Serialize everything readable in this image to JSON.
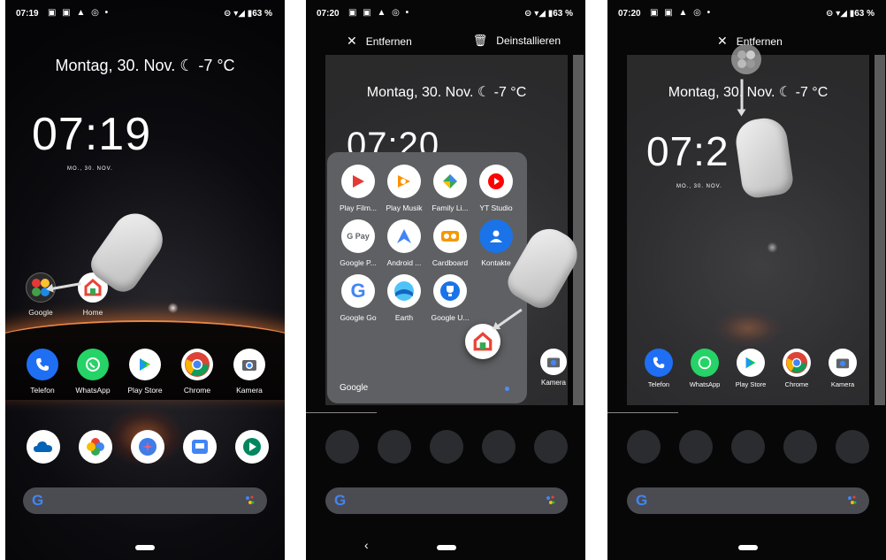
{
  "panels": [
    {
      "status": {
        "time": "07:19",
        "icons": "▣ ▣ ▲ ◎ •",
        "right": "⊝ ▾◢ ▮63 %"
      },
      "date_line": "Montag, 30. Nov. ☾ -7 °C",
      "clock": "07:19",
      "clock_sub": "MO., 30. NOV.",
      "folder_label": "Google",
      "home_label": "Home",
      "dock": [
        {
          "label": "Telefon",
          "icon": "phone-icon",
          "color": "#1e6ff3"
        },
        {
          "label": "WhatsApp",
          "icon": "whatsapp-icon",
          "color": "#25d366"
        },
        {
          "label": "Play Store",
          "icon": "play-store-icon",
          "color": "#ffffff"
        },
        {
          "label": "Chrome",
          "icon": "chrome-icon",
          "color": "#ffffff"
        },
        {
          "label": "Kamera",
          "icon": "camera-icon",
          "color": "#ffffff"
        }
      ],
      "row2": [
        {
          "icon": "onedrive-icon",
          "color": "#ffffff"
        },
        {
          "icon": "google-photos-icon",
          "color": "#ffffff"
        },
        {
          "icon": "bixby-icon",
          "color": "#ffffff"
        },
        {
          "icon": "slides-icon",
          "color": "#ffffff"
        },
        {
          "icon": "play-games-icon",
          "color": "#ffffff"
        }
      ]
    },
    {
      "status": {
        "time": "07:20",
        "icons": "▣ ▣ ▲ ◎ •",
        "right": "⊝ ▾◢ ▮63 %"
      },
      "remove_label": "Entfernen",
      "uninstall_label": "Deinstallieren",
      "date_line": "Montag, 30. Nov. ☾ -7 °C",
      "clock_partial": "07:20",
      "folder": {
        "name": "Google",
        "apps": [
          {
            "label": "Play Film...",
            "icon": "play-movies-icon",
            "color": "#ffffff"
          },
          {
            "label": "Play Musik",
            "icon": "play-music-icon",
            "color": "#ffffff"
          },
          {
            "label": "Family Li...",
            "icon": "family-link-icon",
            "color": "#ffffff"
          },
          {
            "label": "YT Studio",
            "icon": "yt-studio-icon",
            "color": "#ffffff"
          },
          {
            "label": "Google P...",
            "icon": "google-pay-icon",
            "color": "#ffffff"
          },
          {
            "label": "Android ...",
            "icon": "android-auto-icon",
            "color": "#ffffff"
          },
          {
            "label": "Cardboard",
            "icon": "cardboard-icon",
            "color": "#ffffff"
          },
          {
            "label": "Kontakte",
            "icon": "contacts-icon",
            "color": "#1a73e8"
          },
          {
            "label": "Google Go",
            "icon": "google-go-icon",
            "color": "#ffffff"
          },
          {
            "label": "Earth",
            "icon": "earth-icon",
            "color": "#ffffff"
          },
          {
            "label": "Google U...",
            "icon": "google-unlocked-icon",
            "color": "#ffffff"
          }
        ]
      },
      "camera_label": "Kamera",
      "back_glyph": "‹"
    },
    {
      "status": {
        "time": "07:20",
        "icons": "▣ ▣ ▲ ◎ •",
        "right": "⊝ ▾◢ ▮63 %"
      },
      "remove_label": "Entfernen",
      "date_line": "Montag, 30. Nov. ☾ -7 °C",
      "clock_partial": "07:2",
      "clock_sub": "MO., 30. NOV.",
      "dock": [
        {
          "label": "Telefon",
          "icon": "phone-icon",
          "color": "#1e6ff3"
        },
        {
          "label": "WhatsApp",
          "icon": "whatsapp-icon",
          "color": "#25d366"
        },
        {
          "label": "Play Store",
          "icon": "play-store-icon",
          "color": "#ffffff"
        },
        {
          "label": "Chrome",
          "icon": "chrome-icon",
          "color": "#ffffff"
        },
        {
          "label": "Kamera",
          "icon": "camera-icon",
          "color": "#ffffff"
        }
      ]
    }
  ]
}
